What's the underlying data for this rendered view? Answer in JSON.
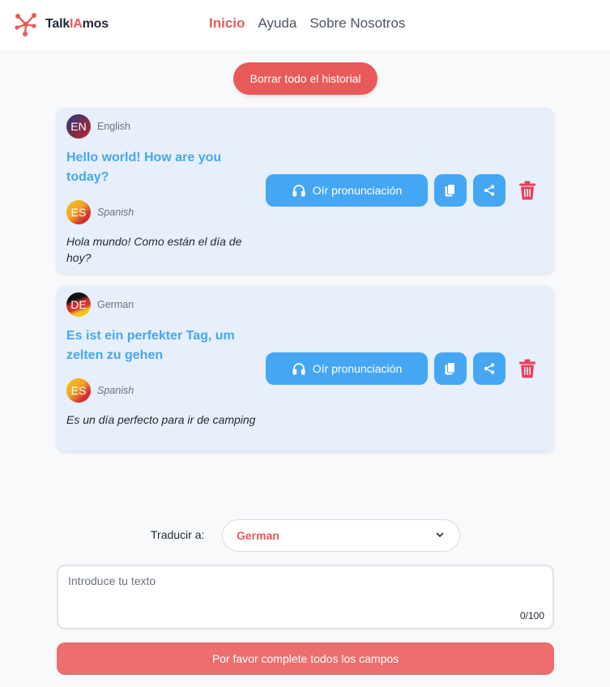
{
  "app": {
    "name_part1": "Talk",
    "name_accent": "IA",
    "name_part2": "mos",
    "accent_color": "#e85a5a",
    "primary_blue": "#45a6f4"
  },
  "nav": {
    "items": [
      {
        "label": "Inicio",
        "active": true
      },
      {
        "label": "Ayuda",
        "active": false
      },
      {
        "label": "Sobre Nosotros",
        "active": false
      }
    ]
  },
  "history": {
    "clear_label": "Borrar todo el historial",
    "entries": [
      {
        "source_flag": "EN",
        "source_lang": "English",
        "source_text": "Hello world! How are you today?",
        "target_flag": "ES",
        "target_lang": "Spanish",
        "target_text": "Hola mundo! Como están el día de hoy?",
        "listen_label": "Oír pronunciación",
        "copy_icon": "copy-icon",
        "share_icon": "share-icon",
        "delete_icon": "trash-icon"
      },
      {
        "source_flag": "DE",
        "source_lang": "German",
        "source_text": "Es ist ein perfekter Tag, um zelten zu gehen",
        "target_flag": "ES",
        "target_lang": "Spanish",
        "target_text": "Es un día perfecto para ir de camping",
        "listen_label": "Oír pronunciación",
        "copy_icon": "copy-icon",
        "share_icon": "share-icon",
        "delete_icon": "trash-icon"
      }
    ]
  },
  "form": {
    "translate_label": "Traducir a:",
    "selected_language": "German",
    "text_placeholder": "Introduce tu texto",
    "text_value": "",
    "counter": "0/100",
    "submit_label": "Por favor complete todos los campos"
  }
}
